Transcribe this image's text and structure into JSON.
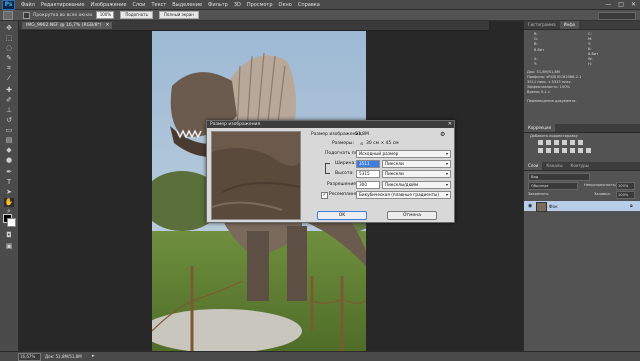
{
  "app": {
    "logo": "Ps"
  },
  "menu": {
    "items": [
      "Файл",
      "Редактирование",
      "Изображение",
      "Слои",
      "Текст",
      "Выделение",
      "Фильтр",
      "3D",
      "Просмотр",
      "Окно",
      "Справка"
    ]
  },
  "window_controls": [
    "—",
    "□",
    "✕"
  ],
  "options_bar": {
    "checkbox_label": "Прокрутка во всех окнах",
    "zoom_value": "100%",
    "fit_button": "Подогнать",
    "fill_button": "Полный экран"
  },
  "document": {
    "tab_title": "IMG_9962.NEF @ 16,7% (RGB/8*)",
    "zoom": "16,67%",
    "doc_size": "Док: 51,8M/51,8M"
  },
  "dialog": {
    "title": "Размер изображения",
    "image_size_label": "Размер изображения:",
    "image_size_value": "51,8M",
    "dimensions_label": "Размеры:",
    "dimensions_value": "30 см × 45 см",
    "fit_to_label": "Подогнать под:",
    "fit_to_value": "Исходный размер",
    "width_label": "Ширина:",
    "width_value": "3511",
    "width_unit": "Пиксели",
    "height_label": "Высота:",
    "height_value": "5315",
    "height_unit": "Пиксели",
    "resolution_label": "Разрешение:",
    "resolution_value": "300",
    "resolution_unit": "Пикселы/дюйм",
    "resample_label": "Ресемплинг:",
    "resample_value": "Бикубическая (плавные градиенты)",
    "resample_checked": true,
    "ok_label": "OK",
    "cancel_label": "Отмена",
    "gear_icon": "⚙",
    "close_icon": "✕"
  },
  "panels": {
    "top_tabs": [
      "Гистограмма",
      "Инфо"
    ],
    "info_lines": [
      "R:",
      "G:",
      "B:",
      "8-бит",
      "C:",
      "M:",
      "Y:",
      "K:",
      "8-бит",
      "X:",
      "Y:",
      "W:",
      "H:"
    ],
    "doc_info": [
      "Док: 51,8M/51,8M",
      "Профиль: sRGB IEC61966-2.1",
      "3511 пикс. x 5315 пикс.",
      "Эффективность: 100%",
      "Время: 0,1 с"
    ],
    "hint": "Перемещение документа.",
    "adjustments_tab": "Коррекция",
    "adjustments_title": "Добавить корректировку",
    "layers_tabs": [
      "Слои",
      "Каналы",
      "Контуры"
    ],
    "kind_label": "Вид",
    "blend_mode": "Обычные",
    "opacity_label": "Непрозрачность:",
    "opacity_value": "100%",
    "lock_label": "Закрепить:",
    "fill_label": "Заливка:",
    "fill_value": "100%",
    "layer_name": "Фон"
  }
}
